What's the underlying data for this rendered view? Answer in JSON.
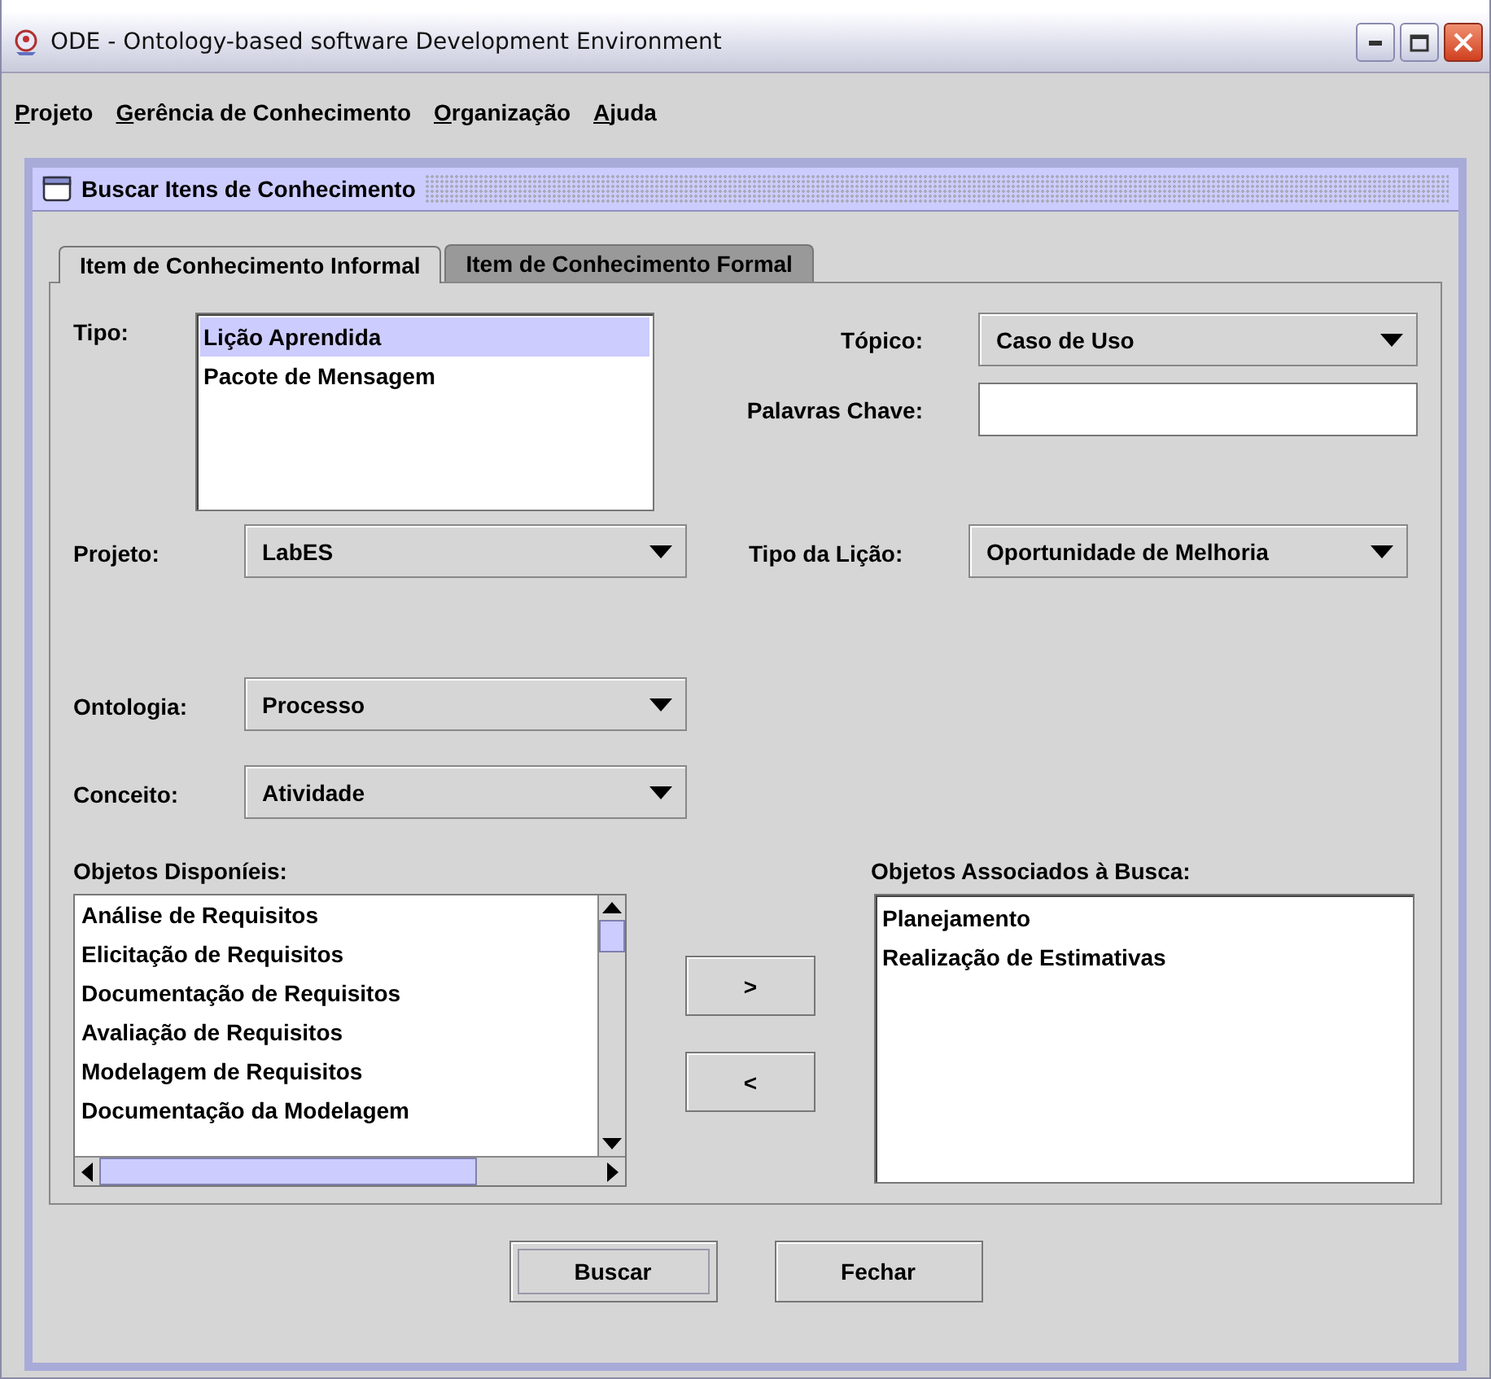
{
  "window": {
    "title": "ODE - Ontology-based software Development Environment"
  },
  "menu": [
    "Projeto",
    "Gerência de Conhecimento",
    "Organização",
    "Ajuda"
  ],
  "frame": {
    "title": "Buscar Itens de Conhecimento"
  },
  "tabs": [
    {
      "label": "Item de Conhecimento Informal",
      "selected": true
    },
    {
      "label": "Item de Conhecimento Formal",
      "selected": false
    }
  ],
  "tipo": {
    "label": "Tipo:",
    "items": [
      {
        "text": "Lição Aprendida",
        "selected": true
      },
      {
        "text": "Pacote de Mensagem",
        "selected": false
      }
    ]
  },
  "topico": {
    "label": "Tópico:",
    "value": "Caso de Uso"
  },
  "palavras_chave": {
    "label": "Palavras Chave:"
  },
  "projeto": {
    "label": "Projeto:",
    "value": "LabES"
  },
  "tipo_licao": {
    "label": "Tipo da Lição:",
    "value": "Oportunidade de Melhoria"
  },
  "ontologia": {
    "label": "Ontologia:",
    "value": "Processo"
  },
  "conceito": {
    "label": "Conceito:",
    "value": "Atividade"
  },
  "disponiveis": {
    "label": "Objetos Disponíeis:",
    "items": [
      "Análise de Requisitos",
      "Elicitação de Requisitos",
      "Documentação de Requisitos",
      "Avaliação de Requisitos",
      "Modelagem de Requisitos",
      "Documentação da Modelagem"
    ]
  },
  "move_buttons": [
    ">",
    "<"
  ],
  "associados": {
    "label": "Objetos Associados à Busca:",
    "items": [
      "Planejamento",
      "Realização de Estimativas"
    ]
  },
  "buttons": [
    {
      "label": "Buscar",
      "focused": true
    },
    {
      "label": "Fechar",
      "focused": false
    }
  ]
}
